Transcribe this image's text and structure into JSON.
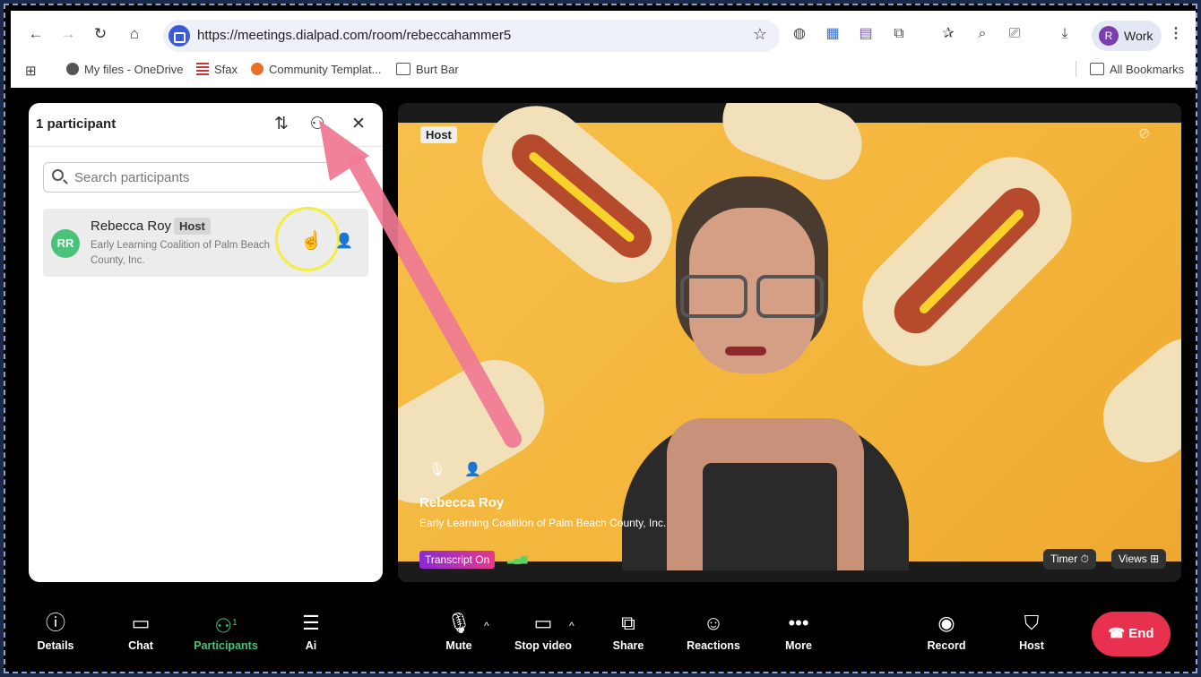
{
  "browser": {
    "url": "https://meetings.dialpad.com/room/rebeccahammer5",
    "profile_initial": "R",
    "profile_label": "Work",
    "bookmarks": [
      "My files - OneDrive",
      "Sfax",
      "Community Templat...",
      "Burt Bar"
    ],
    "all_bookmarks": "All Bookmarks"
  },
  "panel": {
    "title": "1 participant",
    "search_placeholder": "Search participants",
    "participant": {
      "initials": "RR",
      "name": "Rebecca Roy",
      "badge": "Host",
      "org": "Early Learning Coalition of Palm Beach County, Inc."
    }
  },
  "video": {
    "host_label": "Host",
    "name": "Rebecca Roy",
    "org": "Early Learning Coalition of Palm Beach County, Inc.",
    "transcript": "Transcript On",
    "timer": "Timer",
    "views": "Views"
  },
  "toolbar": {
    "details": "Details",
    "chat": "Chat",
    "participants": "Participants",
    "participants_count": "1",
    "ai": "Ai",
    "mute": "Mute",
    "stop_video": "Stop video",
    "share": "Share",
    "reactions": "Reactions",
    "more": "More",
    "record": "Record",
    "host": "Host",
    "end": "End"
  },
  "colors": {
    "accent_green": "#4ac27a",
    "end_red": "#e8304f",
    "arrow_pink": "#f07a95",
    "highlight_yellow": "#f3ef3b"
  }
}
